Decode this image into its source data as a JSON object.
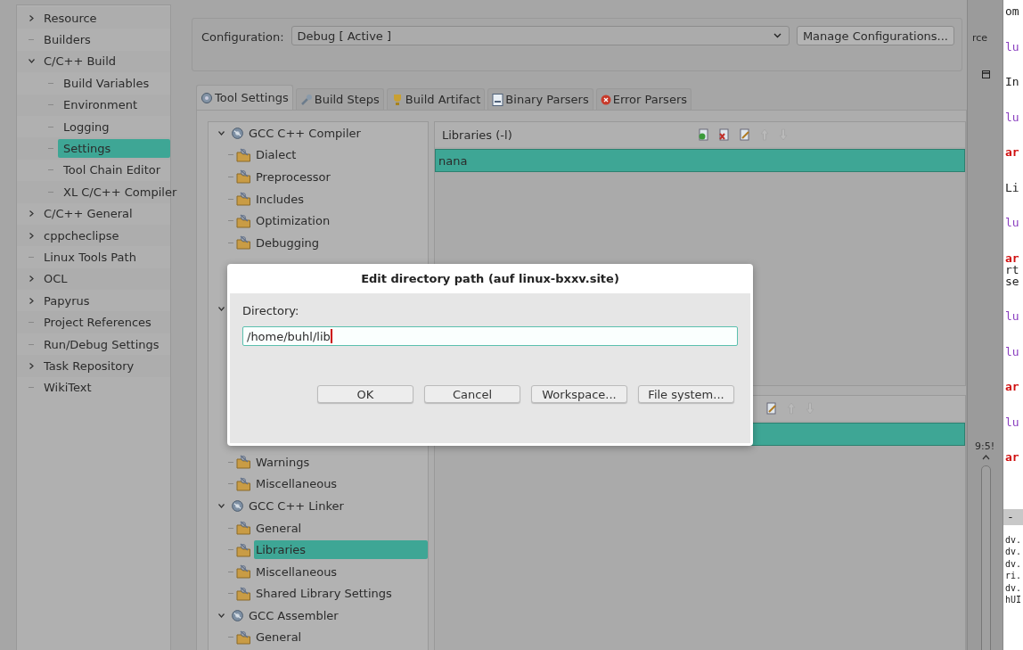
{
  "sidebar": {
    "items": [
      {
        "label": "Resource",
        "expanded": false,
        "selected": false
      },
      {
        "label": "Builders",
        "selected": false
      },
      {
        "label": "C/C++ Build",
        "expanded": true,
        "selected": false,
        "children": [
          {
            "label": "Build Variables",
            "selected": false
          },
          {
            "label": "Environment",
            "selected": false
          },
          {
            "label": "Logging",
            "selected": false
          },
          {
            "label": "Settings",
            "selected": true
          },
          {
            "label": "Tool Chain Editor",
            "selected": false
          },
          {
            "label": "XL C/C++ Compiler",
            "selected": false
          }
        ]
      },
      {
        "label": "C/C++ General",
        "expanded": false,
        "selected": false
      },
      {
        "label": "cppcheclipse",
        "expanded": false,
        "selected": false
      },
      {
        "label": "Linux Tools Path",
        "selected": false
      },
      {
        "label": "OCL",
        "expanded": false,
        "selected": false
      },
      {
        "label": "Papyrus",
        "expanded": false,
        "selected": false
      },
      {
        "label": "Project References",
        "selected": false
      },
      {
        "label": "Run/Debug Settings",
        "selected": false
      },
      {
        "label": "Task Repository",
        "expanded": false,
        "selected": false
      },
      {
        "label": "WikiText",
        "selected": false
      }
    ]
  },
  "configuration": {
    "label": "Configuration:",
    "value": "Debug  [ Active ]",
    "button": "Manage Configurations..."
  },
  "tabs": [
    {
      "label": "Tool Settings",
      "kind": "tool",
      "selected": true
    },
    {
      "label": "Build Steps",
      "kind": "steps",
      "selected": false
    },
    {
      "label": "Build Artifact",
      "kind": "artifact",
      "selected": false
    },
    {
      "label": "Binary Parsers",
      "kind": "binary",
      "selected": false
    },
    {
      "label": "Error Parsers",
      "kind": "error",
      "selected": false
    }
  ],
  "tool_tree": [
    {
      "label": "GCC C++ Compiler",
      "expanded": true,
      "selected": false,
      "children": [
        {
          "label": "Dialect",
          "selected": false
        },
        {
          "label": "Preprocessor",
          "selected": false
        },
        {
          "label": "Includes",
          "selected": false
        },
        {
          "label": "Optimization",
          "selected": false
        },
        {
          "label": "Debugging",
          "selected": false
        }
      ]
    },
    {
      "expanded": true,
      "children": [
        {
          "label": "Warnings",
          "selected": false
        },
        {
          "label": "Miscellaneous",
          "selected": false
        }
      ]
    },
    {
      "label": "GCC C++ Linker",
      "expanded": true,
      "selected": false,
      "children": [
        {
          "label": "General",
          "selected": false
        },
        {
          "label": "Libraries",
          "selected": true
        },
        {
          "label": "Miscellaneous",
          "selected": false
        },
        {
          "label": "Shared Library Settings",
          "selected": false
        }
      ]
    },
    {
      "label": "GCC Assembler",
      "expanded": true,
      "selected": false,
      "children": [
        {
          "label": "General",
          "selected": false
        }
      ]
    }
  ],
  "libraries": {
    "title": "Libraries (-l)",
    "rows": [
      {
        "label": "nana",
        "selected": true
      }
    ]
  },
  "library_paths": {
    "rows": [
      {
        "selected": true
      }
    ]
  },
  "dialog": {
    "title": "Edit directory path  (auf linux-bxxv.site)",
    "label": "Directory:",
    "value": "/home/buhl/lib",
    "buttons": [
      "OK",
      "Cancel",
      "Workspace...",
      "File system..."
    ]
  },
  "side_strip": {
    "label": "rce",
    "time": "9:5!"
  },
  "editor": {
    "lines": [
      {
        "text": "om",
        "kind": "plain"
      },
      {
        "text": "lu",
        "kind": "purple"
      },
      {
        "text": "In",
        "kind": "plain"
      },
      {
        "text": "lu",
        "kind": "purple"
      },
      {
        "text": "ar",
        "kind": "red"
      },
      {
        "text": "Li",
        "kind": "plain"
      },
      {
        "text": "lu",
        "kind": "purple"
      },
      {
        "text": "ar",
        "kind": "red"
      },
      {
        "text": "rt",
        "kind": "cont"
      },
      {
        "text": "se",
        "kind": "cont"
      },
      {
        "text": "lu",
        "kind": "purple"
      },
      {
        "text": "lu",
        "kind": "purple"
      },
      {
        "text": "ar",
        "kind": "red"
      },
      {
        "text": "lu",
        "kind": "purple"
      },
      {
        "text": "ar",
        "kind": "red"
      }
    ],
    "bar": "-",
    "console": [
      "dv.",
      "dv.",
      "dv.",
      "ri.",
      "dv.",
      "hUI"
    ]
  }
}
